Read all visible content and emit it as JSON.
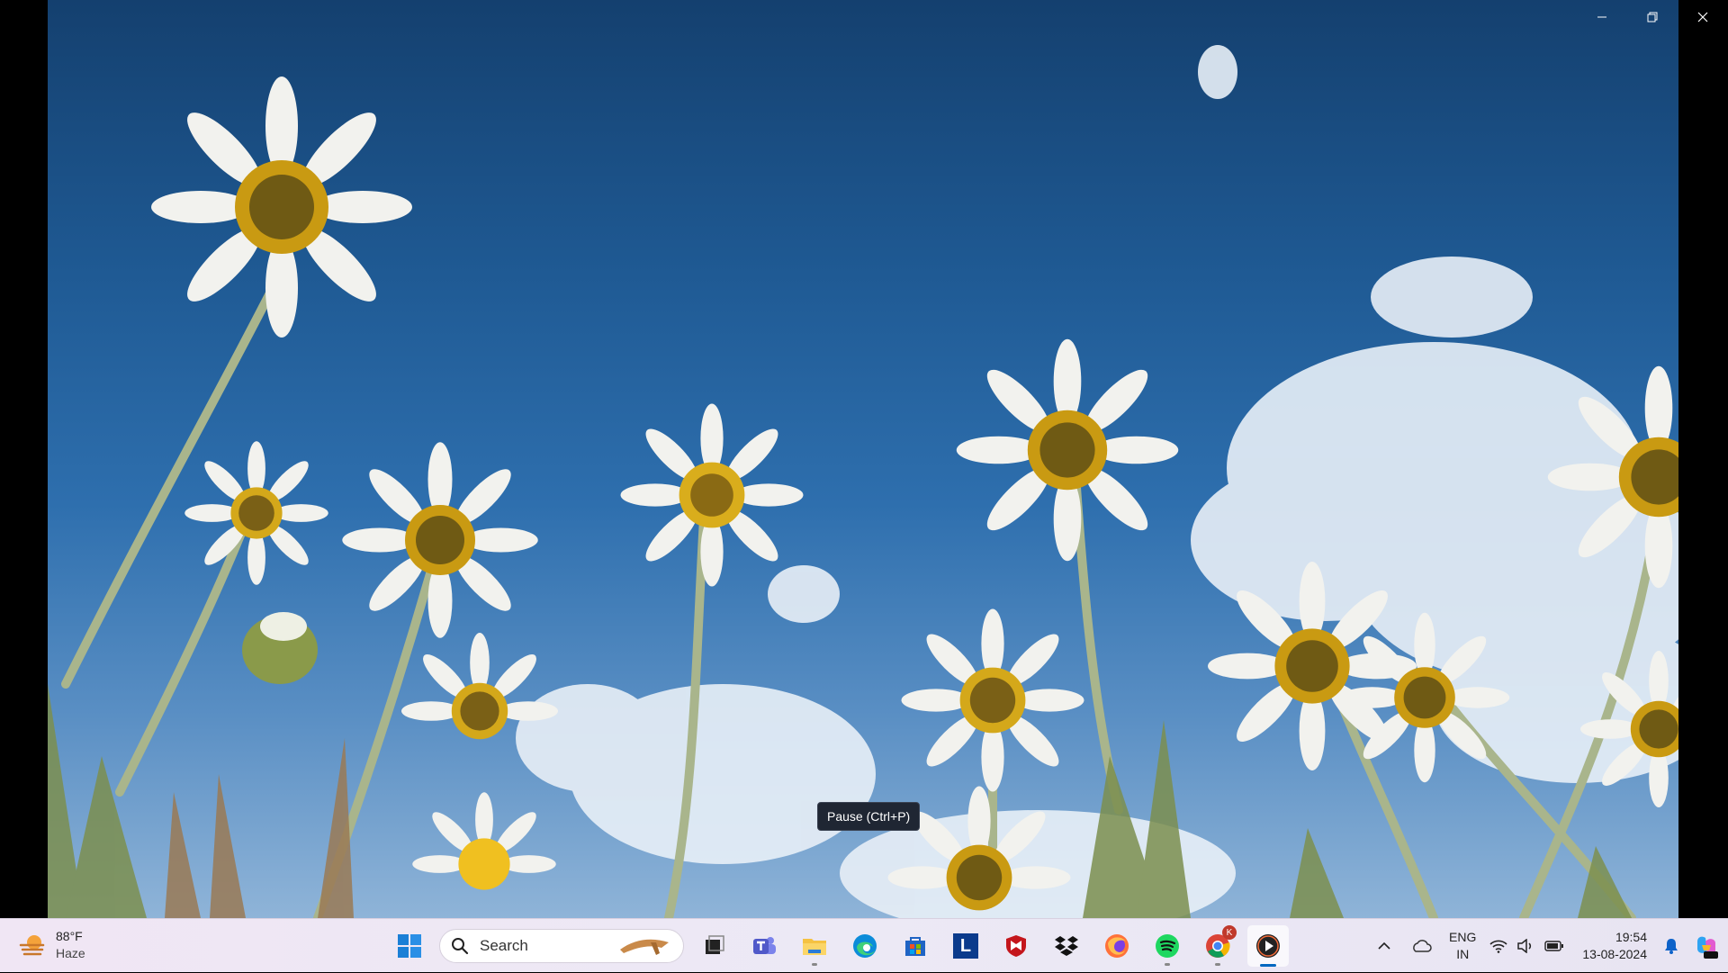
{
  "window_controls": {
    "minimize": "minimize-icon",
    "restore": "restore-icon",
    "close": "close-icon"
  },
  "tooltip": {
    "text": "Pause (Ctrl+P)"
  },
  "taskbar": {
    "weather": {
      "temperature": "88°F",
      "condition": "Haze"
    },
    "search": {
      "placeholder": "Search"
    },
    "apps": [
      {
        "name": "Start",
        "icon": "windows-logo-icon"
      },
      {
        "name": "Task View",
        "icon": "task-view-icon"
      },
      {
        "name": "Microsoft Teams",
        "icon": "teams-icon"
      },
      {
        "name": "File Explorer",
        "icon": "folder-icon"
      },
      {
        "name": "Microsoft Edge",
        "icon": "edge-icon"
      },
      {
        "name": "Microsoft Store",
        "icon": "store-icon"
      },
      {
        "name": "L App",
        "icon": "l-app-icon",
        "label": "L"
      },
      {
        "name": "McAfee",
        "icon": "mcafee-icon"
      },
      {
        "name": "Dropbox",
        "icon": "dropbox-icon"
      },
      {
        "name": "Firefox",
        "icon": "firefox-icon"
      },
      {
        "name": "Spotify",
        "icon": "spotify-icon"
      },
      {
        "name": "Google Chrome",
        "icon": "chrome-icon",
        "badge": "K"
      },
      {
        "name": "Media Player",
        "icon": "media-player-icon"
      }
    ],
    "tray": {
      "language_top": "ENG",
      "language_bottom": "IN",
      "time": "19:54",
      "date": "13-08-2024"
    }
  }
}
